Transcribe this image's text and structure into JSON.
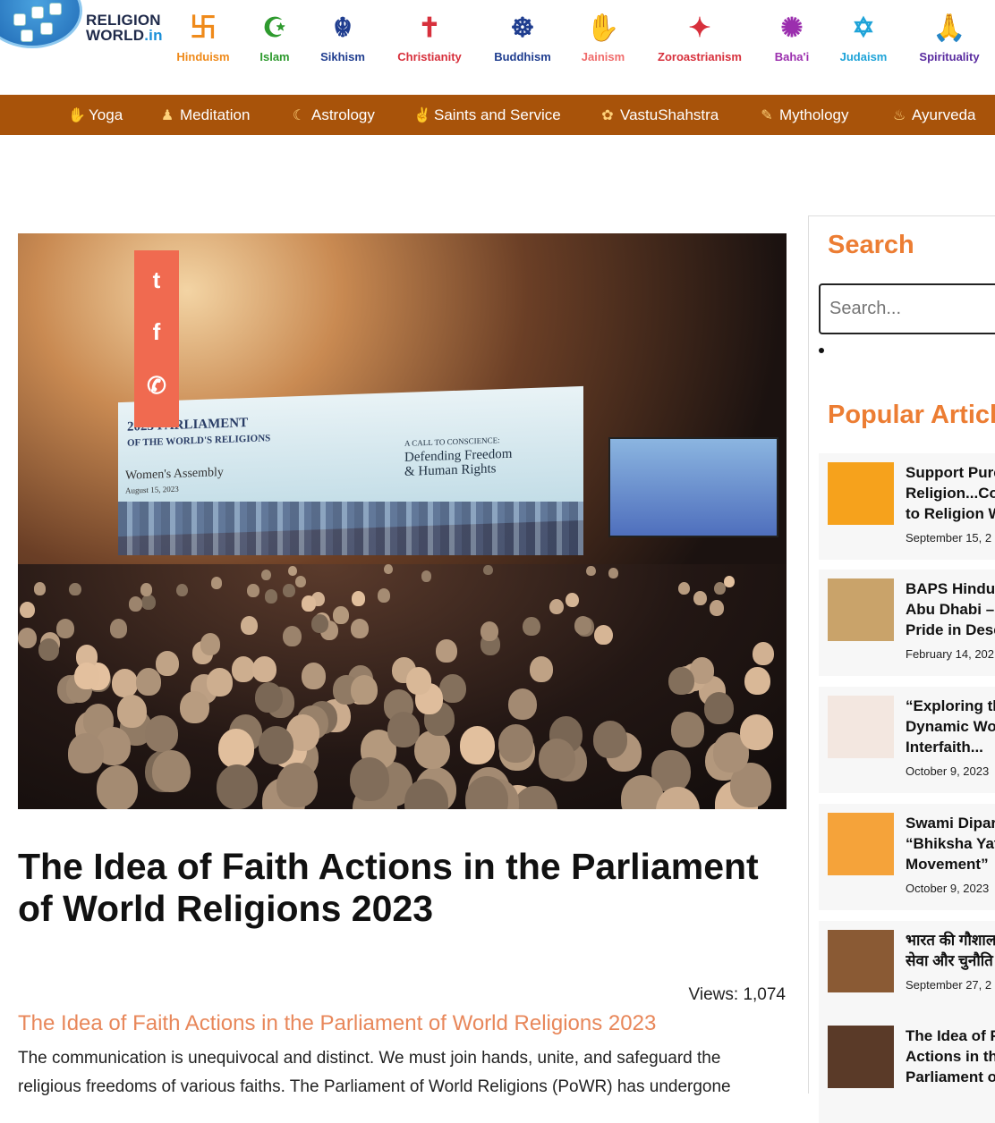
{
  "brand": {
    "line1": "RELIGION",
    "line2": "WORLD",
    "suffix": ".in"
  },
  "religions": [
    {
      "label": "Hinduism",
      "icon": "卐",
      "icon_name": "swastika-icon",
      "color": "#ef8a1a"
    },
    {
      "label": "Islam",
      "icon": "☪",
      "icon_name": "crescent-star-icon",
      "color": "#2e9a2e"
    },
    {
      "label": "Sikhism",
      "icon": "☬",
      "icon_name": "khanda-icon",
      "color": "#1f3d8f"
    },
    {
      "label": "Christianity",
      "icon": "✝",
      "icon_name": "cross-icon",
      "color": "#d7303c"
    },
    {
      "label": "Buddhism",
      "icon": "☸",
      "icon_name": "dharma-wheel-icon",
      "color": "#1f3d8f"
    },
    {
      "label": "Jainism",
      "icon": "✋",
      "icon_name": "jain-hand-icon",
      "color": "#f06b6b"
    },
    {
      "label": "Zoroastrianism",
      "icon": "✦",
      "icon_name": "faravahar-icon",
      "color": "#d7303c"
    },
    {
      "label": "Baha'i",
      "icon": "✺",
      "icon_name": "nine-pointed-star-icon",
      "color": "#9b2fae"
    },
    {
      "label": "Judaism",
      "icon": "✡",
      "icon_name": "star-of-david-icon",
      "color": "#1ea3d8"
    },
    {
      "label": "Spirituality",
      "icon": "🙏",
      "icon_name": "praying-hands-icon",
      "color": "#5a2ca0"
    }
  ],
  "categories": [
    {
      "label": "Yoga",
      "icon": "✋",
      "icon_name": "yoga-icon"
    },
    {
      "label": "Meditation",
      "icon": "♟",
      "icon_name": "meditation-icon"
    },
    {
      "label": "Astrology",
      "icon": "☾",
      "icon_name": "astrology-icon"
    },
    {
      "label": "Saints and Service",
      "icon": "✌",
      "icon_name": "saints-icon"
    },
    {
      "label": "VastuShahstra",
      "icon": "✿",
      "icon_name": "vastu-icon"
    },
    {
      "label": "Mythology",
      "icon": "✎",
      "icon_name": "mythology-icon"
    },
    {
      "label": "Ayurveda",
      "icon": "♨",
      "icon_name": "ayurveda-icon"
    }
  ],
  "hero": {
    "screen_title_1": "2023 PARLIAMENT",
    "screen_title_2": "OF THE WORLD'S RELIGIONS",
    "screen_assembly": "Women's Assembly",
    "screen_date": "August 15, 2023",
    "screen_call": "A CALL TO CONSCIENCE:",
    "screen_slogan_1": "Defending Freedom",
    "screen_slogan_2": "& Human Rights"
  },
  "share": [
    {
      "label": "t",
      "icon_name": "twitter-icon"
    },
    {
      "label": "f",
      "icon_name": "facebook-icon"
    },
    {
      "label": "✆",
      "icon_name": "whatsapp-icon"
    }
  ],
  "article": {
    "title": "The Idea of Faith Actions in the Parliament of World Religions 2023",
    "views": "Views: 1,074",
    "subtitle": "The Idea of Faith Actions in the Parliament of World Religions 2023",
    "body": "The communication is unequivocal and distinct. We must join hands, unite, and safeguard the religious freedoms of various faiths. The Parliament of World Religions (PoWR) has undergone"
  },
  "sidebar": {
    "search_heading": "Search",
    "search_placeholder": "Search...",
    "popular_heading": "Popular Articles",
    "articles": [
      {
        "title_lines": [
          "Support Pure",
          "Religion...Co",
          "to Religion W"
        ],
        "date": "September 15, 2",
        "thumb": "#f6a21c"
      },
      {
        "title_lines": [
          "BAPS Hindu",
          "Abu Dhabi –",
          "Pride in Dese"
        ],
        "date": "February 14, 202",
        "thumb": "#c9a36a"
      },
      {
        "title_lines": [
          "“Exploring th",
          "Dynamic Wo",
          "Interfaith..."
        ],
        "date": "October 9, 2023",
        "thumb": "#f3e7e0"
      },
      {
        "title_lines": [
          "Swami Dipar",
          "“Bhiksha Yat",
          "Movement”"
        ],
        "date": "October 9, 2023",
        "thumb": "#f5a33a"
      },
      {
        "title_lines": [
          "भारत की गौशाल",
          "सेवा और चुनौति"
        ],
        "date": "September 27, 2",
        "thumb": "#8a5a34"
      },
      {
        "title_lines": [
          "The Idea of F",
          "Actions in th",
          "Parliament o"
        ],
        "date": "",
        "thumb": "#5a3a28"
      }
    ]
  }
}
